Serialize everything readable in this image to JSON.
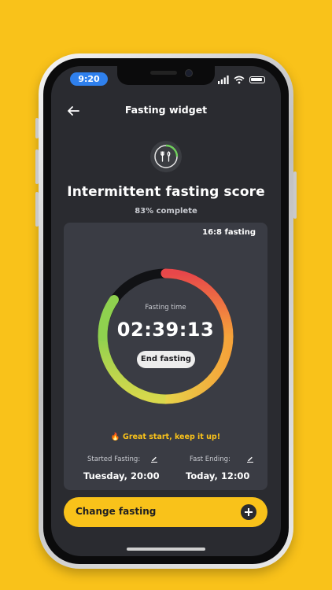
{
  "status_bar": {
    "time": "9:20"
  },
  "header": {
    "title": "Fasting widget"
  },
  "score": {
    "title": "Intermittent fasting score",
    "progress_text": "83% complete"
  },
  "card": {
    "plan": "16:8 fasting",
    "fasting_time_label": "Fasting time",
    "timer": "02:39:13",
    "end_button": "End fasting",
    "encouragement": "🔥 Great start, keep it up!",
    "started_label": "Started Fasting:",
    "started_value": "Tuesday, 20:00",
    "ending_label": "Fast Ending:",
    "ending_value": "Today,  12:00"
  },
  "change_button": {
    "label": "Change fasting"
  },
  "colors": {
    "background": "#F9C21A",
    "screen": "#2a2b30",
    "card": "#3a3c44",
    "accent": "#F9C21A",
    "ring_gradient": [
      "#F57C20",
      "#E8474A",
      "#F7B531",
      "#8FD14F"
    ]
  }
}
